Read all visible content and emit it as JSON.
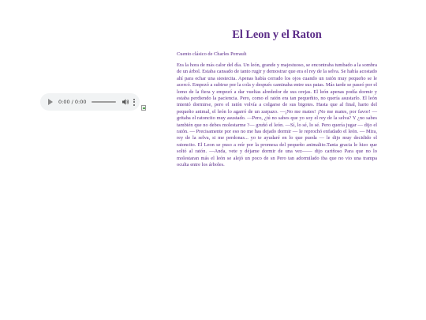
{
  "audio_player": {
    "time": "0:00 / 0:00",
    "play_icon": "play-icon",
    "volume_icon": "volume-icon",
    "more_icon": "more-vertical-icon"
  },
  "image": {
    "state": "broken-image-icon"
  },
  "page": {
    "title": "El Leon y el Raton",
    "subtitle": "Cuento clásico de Charles Perrault",
    "story": "Era la hora de más calor del día. Un león, grande y majestuoso, se encontraba tumbado a la sombra de un árbol. Estaba cansado de tanto rugir y demostrar que era el rey de la selva. Se había acostado ahí para echar una siestecita. Apenas había cerrado los ojos cuando un ratón muy pequeño se le acercó. Empezó a subirse por la cola y después caminaba entre sus patas. Más tarde se paseó por el lomo de la fiera y empezó a dar vueltas alrededor de sus orejas. El león apenas podía dormir y estaba perdiendo la paciencia. Pero, como el ratón era tan pequeñito, no quería asustarlo. El león intentó dormirse, pero el ratón volvía a colgarse de sus bigotes. Hasta que al final, harto del pequeño animal, el león lo agarró de un zarpazo. —¡No me mates! ¡No me mates, por favor! — gritaba el ratoncito muy asustado. —Pero, ¿tú no sabes que yo soy el rey de la selva? Y ¿no sabes también que no debes molestarme ?— gruñó el león. —Sí, lo sé, lo sé. Pero quería jugar — dijo el ratón. — Precisamente por eso no me has dejado dormir — le reprochó enfadado el león. — Mira, rey de la selva, si me perdonas... yo te ayudaré en lo que pueda — le dijo muy decidido el ratoncito. El Leon se puso a reír por la promesa del pequeño animalito.Tanta gracia le hizo que soltó al ratón. —Anda, vete y déjame dormir de una vez—— dijo cariñoso Para que no lo molestaran más el león se alejó un poco de sn Pero tan adormilado iba que no vio una trampa oculta entre los árboles."
  }
}
